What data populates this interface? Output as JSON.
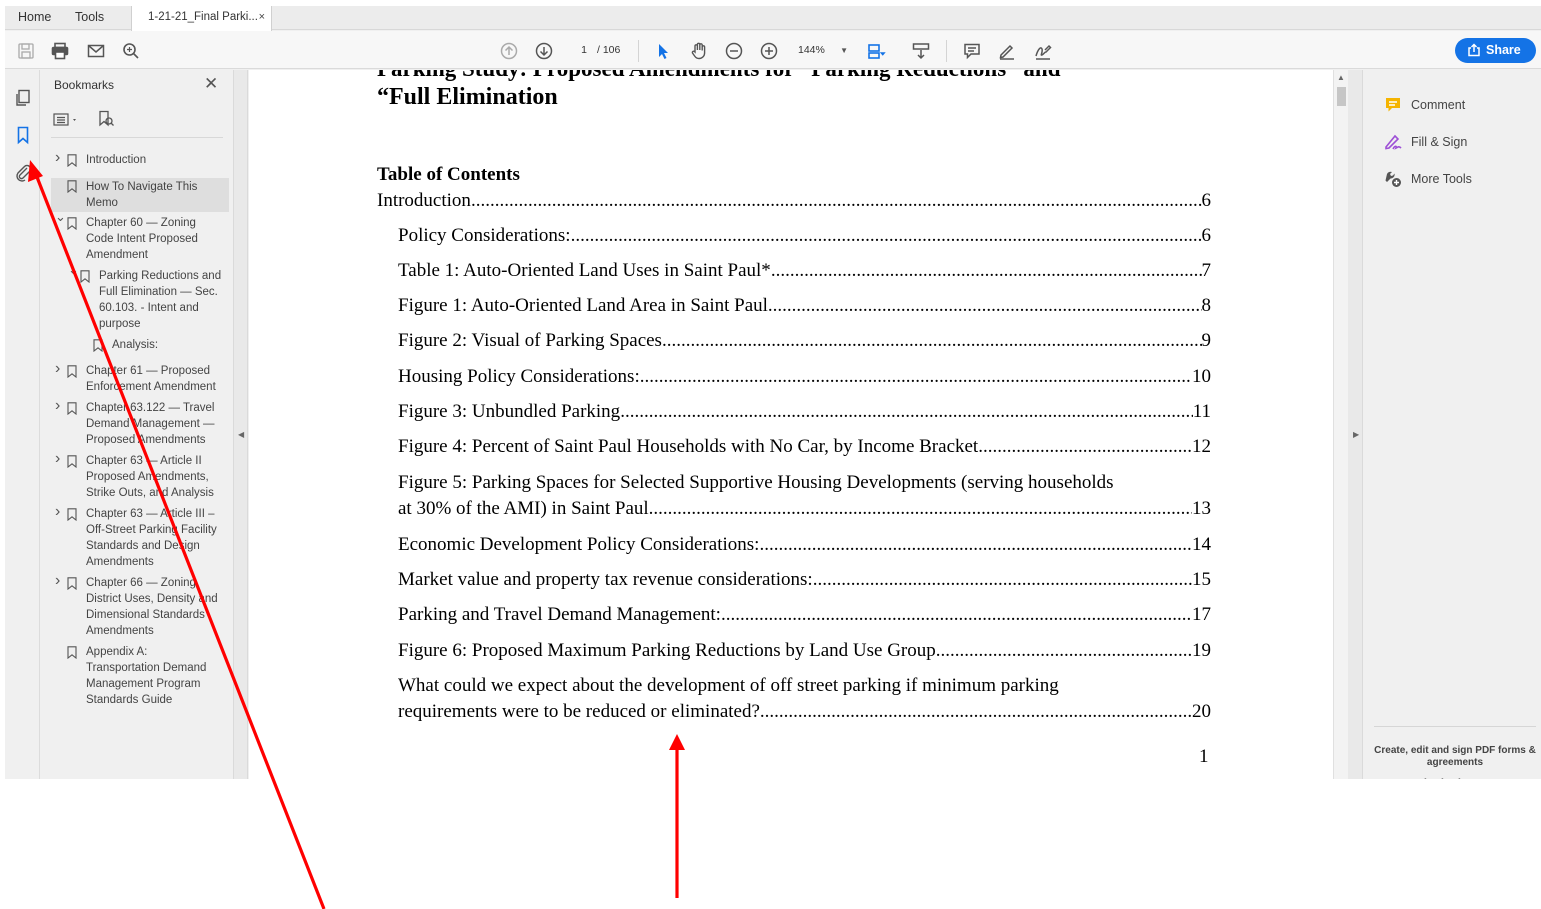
{
  "menubar": {
    "home": "Home",
    "tools": "Tools",
    "tab_title": "1-21-21_Final Parki...",
    "tab_close": "×"
  },
  "toolbar": {
    "page_current": "1",
    "page_total": "/ 106",
    "zoom": "144%",
    "share_label": "Share"
  },
  "bookmarks": {
    "title": "Bookmarks",
    "close": "✕",
    "items": [
      {
        "label": "Introduction",
        "chevron": "›",
        "level": 0
      },
      {
        "label": "How To Navigate This Memo",
        "chevron": "",
        "level": 0,
        "selected": true
      },
      {
        "label": "Chapter 60 — Zoning Code Intent Proposed Amendment",
        "chevron": "⌄",
        "level": 0
      },
      {
        "label": "Parking Reductions and Full Elimination — Sec. 60.103. - Intent and purpose",
        "chevron": "⌄",
        "level": 1
      },
      {
        "label": "Analysis:",
        "chevron": "",
        "level": 2
      },
      {
        "label": "Chapter 61 — Proposed Enforcement Amendment",
        "chevron": "›",
        "level": 0
      },
      {
        "label": "Chapter 63.122 — Travel Demand Management — Proposed Amendments",
        "chevron": "›",
        "level": 0
      },
      {
        "label": "Chapter 63 — Article II Proposed Amendments, Strike Outs, and Analysis",
        "chevron": "›",
        "level": 0
      },
      {
        "label": "Chapter 63 — Article III – Off-Street Parking Facility Standards and Design Amendments",
        "chevron": "›",
        "level": 0
      },
      {
        "label": "Chapter 66 — Zoning District Uses, Density and Dimensional Standards Amendments",
        "chevron": "›",
        "level": 0
      },
      {
        "label": "Appendix A: Transportation Demand Management Program Standards Guide",
        "chevron": "",
        "level": 0
      }
    ]
  },
  "document": {
    "title_line1": "Parking Study: Proposed Amendments for “Parking Reductions” and",
    "title_line2": "“Full Elimination",
    "toc_heading": "Table of Contents",
    "toc": [
      {
        "text": "Introduction",
        "page": "6"
      },
      {
        "text": "Policy Considerations: ",
        "page": "6"
      },
      {
        "text": "Table 1: Auto-Oriented Land Uses in Saint Paul*",
        "page": "7"
      },
      {
        "text": "Figure 1: Auto-Oriented Land Area in Saint Paul ",
        "page": "8"
      },
      {
        "text": "Figure 2: Visual of Parking Spaces",
        "page": "9"
      },
      {
        "text": "Housing Policy Considerations:",
        "page": "10"
      },
      {
        "text": "Figure 3: Unbundled Parking",
        "page": "11"
      },
      {
        "text": "Figure 4: Percent of Saint Paul Households with No Car, by Income Bracket ",
        "page": "12"
      },
      {
        "text": "Figure 5: Parking Spaces for Selected Supportive Housing Developments (serving households",
        "text2": "at 30% of the AMI) in Saint Paul",
        "page": "13"
      },
      {
        "text": "Economic Development Policy Considerations: ",
        "page": "14"
      },
      {
        "text": "Market value and property tax revenue considerations: ",
        "page": "15"
      },
      {
        "text": "Parking and Travel Demand Management: ",
        "page": "17"
      },
      {
        "text": "Figure 6: Proposed Maximum Parking Reductions by Land Use Group ",
        "page": "19"
      },
      {
        "text": "What could we expect about the development of off street parking if minimum parking",
        "text2": "requirements were to be reduced or eliminated? ",
        "page": "20"
      }
    ],
    "page_number": "1"
  },
  "right_pane": {
    "comment": "Comment",
    "fill_sign": "Fill & Sign",
    "more_tools": "More Tools",
    "promo": "Create, edit and sign PDF forms & agreements"
  },
  "colors": {
    "accent": "#1473e6",
    "annotation": "#ff0000",
    "comment_icon": "#f5b400",
    "fill_sign_icon": "#9d4fd6"
  }
}
